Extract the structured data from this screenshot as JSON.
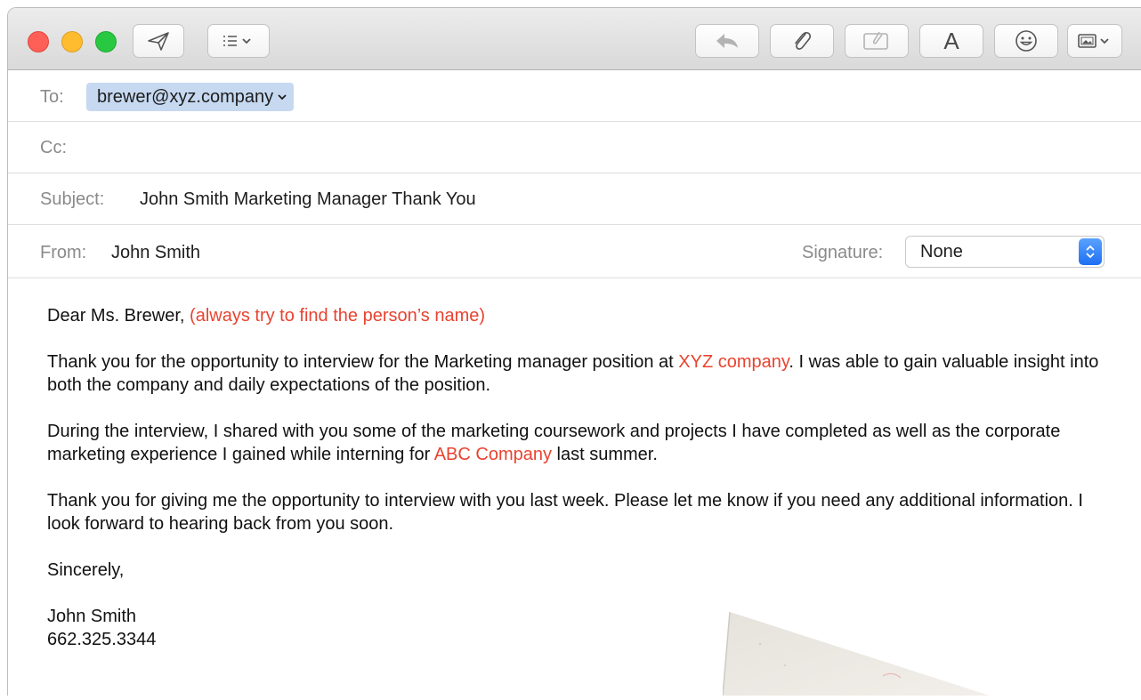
{
  "toolbar": {
    "buttons": [
      {
        "name": "send-icon"
      },
      {
        "name": "header-fields-icon"
      },
      {
        "name": "reply-icon"
      },
      {
        "name": "attach-icon"
      },
      {
        "name": "markup-icon"
      },
      {
        "name": "format-icon",
        "label": "A"
      },
      {
        "name": "emoji-icon"
      },
      {
        "name": "photo-browser-icon"
      }
    ]
  },
  "header": {
    "to_label": "To:",
    "to_recipient": "brewer@xyz.company",
    "cc_label": "Cc:",
    "cc_value": "",
    "subject_label": "Subject:",
    "subject_value": "John Smith Marketing Manager Thank You",
    "from_label": "From:",
    "from_value": "John Smith",
    "signature_label": "Signature:",
    "signature_value": "None"
  },
  "body": {
    "greeting": "Dear Ms. Brewer,",
    "greeting_note": "(always try to find the person’s name)",
    "p1_a": "Thank you for the opportunity to interview for the Marketing manager position at ",
    "p1_company": "XYZ company",
    "p1_b": ". I was able to gain valuable insight into both the company and daily expectations of the position.",
    "p2_a": "During the interview, I shared with you some of the marketing coursework and projects I have completed as well as the corporate marketing experience I gained while interning for ",
    "p2_company": "ABC Company",
    "p2_b": " last summer.",
    "p3": "Thank you for giving me the opportunity to interview with you last week. Please let me know if you need any additional information. I look forward to hearing back from you soon.",
    "closing": "Sincerely,",
    "sig_name": "John Smith",
    "sig_phone": "662.325.3344"
  },
  "colors": {
    "highlight_red": "#e8432f",
    "token_blue": "#c6d9f1"
  }
}
